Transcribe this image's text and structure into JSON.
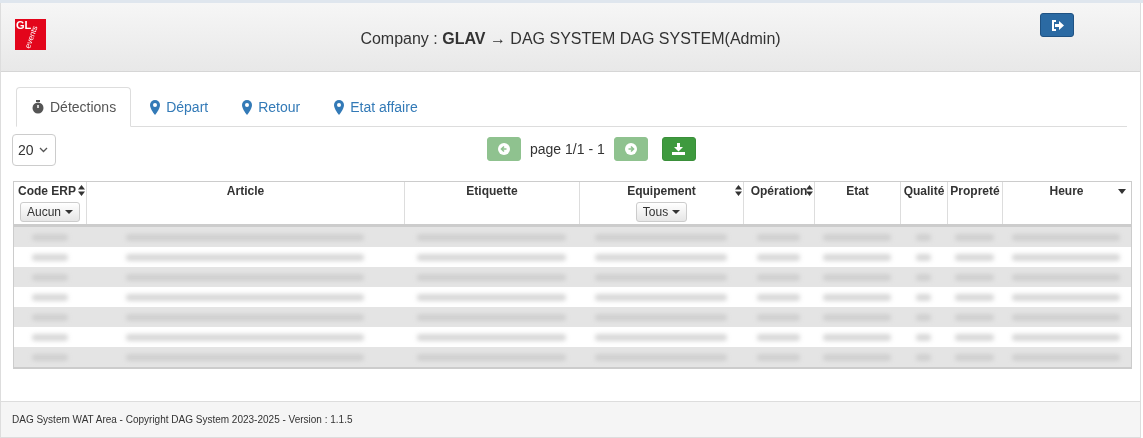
{
  "logo": {
    "top": "GL",
    "bottom": "events"
  },
  "header": {
    "prefix": "Company : ",
    "company": "GLAV",
    "arrow": "→",
    "user": "DAG SYSTEM DAG SYSTEM(Admin)"
  },
  "tabs": [
    {
      "label": "Détections",
      "kind": "stopwatch",
      "selected": true
    },
    {
      "label": "Départ",
      "kind": "marker",
      "selected": false
    },
    {
      "label": "Retour",
      "kind": "marker",
      "selected": false
    },
    {
      "label": "Etat affaire",
      "kind": "marker",
      "selected": false
    }
  ],
  "page_size": "20",
  "pager": {
    "text": "page 1/1 - 1",
    "prev_disabled": true,
    "next_disabled": true
  },
  "columns": [
    {
      "label": "Code ERP",
      "kind": "sortable",
      "filter": "Aucun"
    },
    {
      "label": "Article",
      "kind": "plain"
    },
    {
      "label": "Etiquette",
      "kind": "plain"
    },
    {
      "label": "Equipement",
      "kind": "sortable",
      "filter": "Tous"
    },
    {
      "label": "Opération",
      "kind": "sortable"
    },
    {
      "label": "Etat",
      "kind": "plain"
    },
    {
      "label": "Qualité",
      "kind": "plain"
    },
    {
      "label": "Propreté",
      "kind": "plain"
    },
    {
      "label": "Heure",
      "kind": "descending"
    }
  ],
  "rows": [
    {
      "kind": "blurred"
    },
    {
      "kind": "blurred"
    },
    {
      "kind": "blurred"
    },
    {
      "kind": "blurred"
    },
    {
      "kind": "blurred"
    },
    {
      "kind": "blurred"
    },
    {
      "kind": "blurred"
    }
  ],
  "footer": "DAG System WAT Area - Copyright DAG System 2023-2025 - Version : 1.1.5"
}
